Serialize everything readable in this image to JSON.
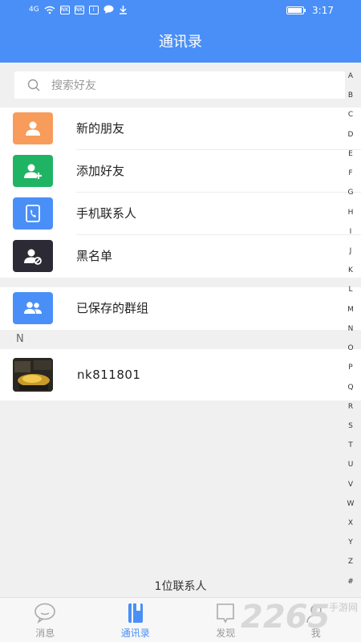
{
  "statusbar": {
    "signal": "4G",
    "icons": [
      "wifi-icon",
      "nk-icon",
      "nk-icon",
      "info-icon",
      "chat-icon",
      "download-icon"
    ],
    "nk1": "NK",
    "nk2": "NK",
    "i": "i",
    "time": "3:17"
  },
  "appbar": {
    "title": "通讯录"
  },
  "search": {
    "placeholder": "搜索好友"
  },
  "menu": [
    {
      "label": "新的朋友",
      "color": "#f79c5a",
      "icon": "new-friend-icon"
    },
    {
      "label": "添加好友",
      "color": "#1fb463",
      "icon": "add-friend-icon"
    },
    {
      "label": "手机联系人",
      "color": "#4a8ff7",
      "icon": "phone-contacts-icon"
    },
    {
      "label": "黑名单",
      "color": "#2c2b35",
      "icon": "blacklist-icon"
    }
  ],
  "groups": {
    "label": "已保存的群组",
    "color": "#4a8ff7",
    "icon": "groups-icon"
  },
  "section": {
    "letter": "N"
  },
  "contact": {
    "name": "nk811801"
  },
  "index": [
    "A",
    "B",
    "C",
    "D",
    "E",
    "F",
    "G",
    "H",
    "I",
    "J",
    "K",
    "L",
    "M",
    "N",
    "O",
    "P",
    "Q",
    "R",
    "S",
    "T",
    "U",
    "V",
    "W",
    "X",
    "Y",
    "Z",
    "#"
  ],
  "footer": {
    "count": "1位联系人"
  },
  "tabs": [
    {
      "label": "消息",
      "icon": "message-icon",
      "active": false
    },
    {
      "label": "通讯录",
      "icon": "contacts-icon",
      "active": true
    },
    {
      "label": "发现",
      "icon": "discover-icon",
      "active": false
    },
    {
      "label": "我",
      "icon": "me-icon",
      "active": false
    }
  ],
  "watermark": {
    "num": "2265",
    "text": "手游网"
  },
  "colors": {
    "accent": "#4a8ff7",
    "background": "#f0f0f0"
  }
}
